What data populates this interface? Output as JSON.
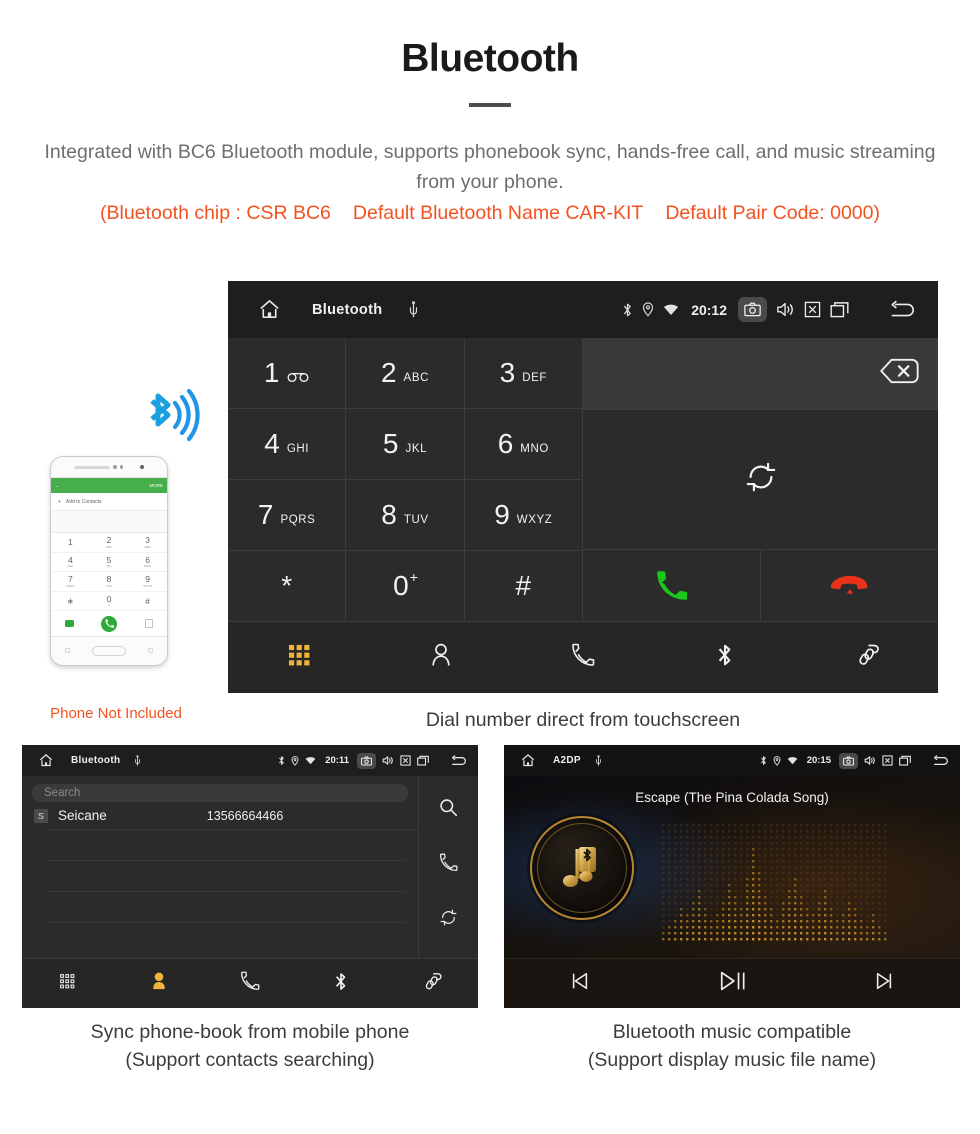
{
  "header": {
    "title": "Bluetooth",
    "description": "Integrated with BC6 Bluetooth module, supports phonebook sync, hands-free call, and music streaming from your phone.",
    "spec_chip": "(Bluetooth chip : CSR BC6",
    "spec_name": "Default Bluetooth Name CAR-KIT",
    "spec_pair": "Default Pair Code: 0000)",
    "accent_color": "#f4511e",
    "muted_color": "#6e6e6e"
  },
  "dialer": {
    "status": {
      "title": "Bluetooth",
      "time": "20:12",
      "icons": [
        "home-icon",
        "usb-icon",
        "bluetooth-icon",
        "location-icon",
        "wifi-icon",
        "camera-icon",
        "volume-icon",
        "close-icon",
        "recents-icon",
        "back-icon"
      ]
    },
    "keys": [
      {
        "digit": "1",
        "letters": "",
        "voicemail": true
      },
      {
        "digit": "2",
        "letters": "ABC"
      },
      {
        "digit": "3",
        "letters": "DEF"
      },
      {
        "digit": "4",
        "letters": "GHI"
      },
      {
        "digit": "5",
        "letters": "JKL"
      },
      {
        "digit": "6",
        "letters": "MNO"
      },
      {
        "digit": "7",
        "letters": "PQRS"
      },
      {
        "digit": "8",
        "letters": "TUV"
      },
      {
        "digit": "9",
        "letters": "WXYZ"
      },
      {
        "digit": "*",
        "letters": ""
      },
      {
        "digit": "0",
        "letters": "",
        "sup": "+"
      },
      {
        "digit": "#",
        "letters": ""
      }
    ],
    "number_display": "",
    "actions": {
      "backspace": "backspace-icon",
      "sync": "sync-icon",
      "call": "call-icon",
      "hangup": "hangup-icon",
      "call_color": "#1ec81e",
      "hangup_color": "#e8321a"
    },
    "nav": [
      {
        "name": "keypad",
        "icon": "keypad-icon",
        "active": true
      },
      {
        "name": "contacts",
        "icon": "person-icon",
        "active": false
      },
      {
        "name": "call-log",
        "icon": "handset-icon",
        "active": false
      },
      {
        "name": "bluetooth",
        "icon": "bluetooth-icon",
        "active": false
      },
      {
        "name": "link",
        "icon": "link-icon",
        "active": false
      }
    ],
    "active_color": "#f2b33d",
    "caption": "Dial number direct from touchscreen"
  },
  "phone_mock": {
    "app_back": "←",
    "app_more": "MORE",
    "add_to_contacts": "Add to Contacts",
    "keys": [
      {
        "digit": "1",
        "sub": ""
      },
      {
        "digit": "2",
        "sub": "ABC"
      },
      {
        "digit": "3",
        "sub": "DEF"
      },
      {
        "digit": "4",
        "sub": "GHI"
      },
      {
        "digit": "5",
        "sub": "JKL"
      },
      {
        "digit": "6",
        "sub": "MNO"
      },
      {
        "digit": "7",
        "sub": "PQRS"
      },
      {
        "digit": "8",
        "sub": "TUV"
      },
      {
        "digit": "9",
        "sub": "WXYZ"
      },
      {
        "digit": "∗",
        "sub": ""
      },
      {
        "digit": "0",
        "sub": "+"
      },
      {
        "digit": "#",
        "sub": ""
      }
    ],
    "note": "Phone Not Included",
    "note_color": "#f4511e",
    "bluetooth_color": "#1a9fe0"
  },
  "phonebook": {
    "status": {
      "title": "Bluetooth",
      "time": "20:11"
    },
    "search_placeholder": "Search",
    "contacts": [
      {
        "initial": "S",
        "name": "Seicane",
        "number": "13566664466"
      }
    ],
    "side_actions": [
      "search-icon",
      "call-icon",
      "sync-icon"
    ],
    "nav": [
      {
        "name": "keypad",
        "icon": "keypad-icon",
        "active": false
      },
      {
        "name": "contacts",
        "icon": "person-icon",
        "active": true
      },
      {
        "name": "call-log",
        "icon": "handset-icon",
        "active": false
      },
      {
        "name": "bluetooth",
        "icon": "bluetooth-icon",
        "active": false
      },
      {
        "name": "link",
        "icon": "link-icon",
        "active": false
      }
    ],
    "caption_line1": "Sync phone-book from mobile phone",
    "caption_line2": "(Support contacts searching)"
  },
  "music": {
    "status": {
      "title": "A2DP",
      "time": "20:15"
    },
    "song_title": "Escape (The Pina Colada Song)",
    "controls": [
      {
        "name": "previous",
        "icon": "prev-track-icon"
      },
      {
        "name": "play-pause",
        "icon": "play-pause-icon"
      },
      {
        "name": "next",
        "icon": "next-track-icon"
      }
    ],
    "accent_color": "#c8962c",
    "caption_line1": "Bluetooth music compatible",
    "caption_line2": "(Support display music file name)"
  }
}
